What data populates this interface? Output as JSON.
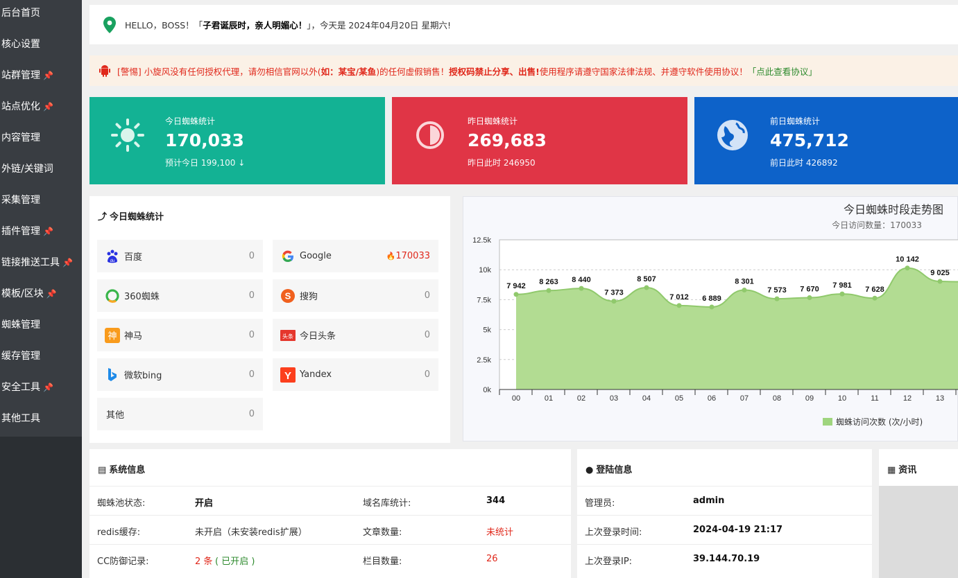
{
  "sidebar": {
    "items": [
      {
        "label": "后台首页",
        "pinned": false
      },
      {
        "label": "核心设置",
        "pinned": false
      },
      {
        "label": "站群管理",
        "pinned": true
      },
      {
        "label": "站点优化",
        "pinned": true
      },
      {
        "label": "内容管理",
        "pinned": false
      },
      {
        "label": "外链/关键词",
        "pinned": false
      },
      {
        "label": "采集管理",
        "pinned": false
      },
      {
        "label": "插件管理",
        "pinned": true
      },
      {
        "label": "链接推送工具",
        "pinned": true
      },
      {
        "label": "模板/区块",
        "pinned": true
      },
      {
        "label": "蜘蛛管理",
        "pinned": false
      },
      {
        "label": "缓存管理",
        "pinned": false
      },
      {
        "label": "安全工具",
        "pinned": true
      },
      {
        "label": "其他工具",
        "pinned": false
      }
    ]
  },
  "welcome": {
    "prefix": "HELLO，BOSS！「",
    "quote": "子君诞辰时，亲人明媚心！",
    "suffix": "」，今天是 2024年04月20日 星期六!"
  },
  "warning": {
    "p1": "[警惕] 小旋风没有任何授权代理，请勿相信官网以外(",
    "p2": "如：某宝/某鱼",
    "p3": ")的任何虚假销售！",
    "p4": "授权码禁止分享、出售!",
    "p5": " 使用程序请遵守国家法律法规、并遵守软件使用协议！",
    "link": "「点此查看协议」"
  },
  "stats": [
    {
      "title": "今日蜘蛛统计",
      "value": "170,033",
      "sub": "预计今日 199,100",
      "arrow": "↓",
      "color": "#13b294",
      "icon": "sun-icon"
    },
    {
      "title": "昨日蜘蛛统计",
      "value": "269,683",
      "sub": "昨日此时 246950",
      "arrow": "",
      "color": "#e03546",
      "icon": "half-circle-icon"
    },
    {
      "title": "前日蜘蛛统计",
      "value": "475,712",
      "sub": "前日此时 426892",
      "arrow": "",
      "color": "#0d62c9",
      "icon": "globe-icon"
    }
  ],
  "spider_panel": {
    "title": "今日蜘蛛统计",
    "engines": [
      {
        "name": "百度",
        "value": "0",
        "icon": "baidu-icon"
      },
      {
        "name": "Google",
        "value": "170033",
        "icon": "google-icon",
        "hot": true
      },
      {
        "name": "360蜘蛛",
        "value": "0",
        "icon": "360-icon"
      },
      {
        "name": "搜狗",
        "value": "0",
        "icon": "sogou-icon"
      },
      {
        "name": "神马",
        "value": "0",
        "icon": "shenma-icon"
      },
      {
        "name": "今日头条",
        "value": "0",
        "icon": "toutiao-icon"
      },
      {
        "name": "微软bing",
        "value": "0",
        "icon": "bing-icon"
      },
      {
        "name": "Yandex",
        "value": "0",
        "icon": "yandex-icon"
      },
      {
        "name": "其他",
        "value": "0",
        "icon": ""
      }
    ]
  },
  "chart_data": {
    "type": "area",
    "title": "今日蜘蛛时段走势图",
    "subtitle": "今日访问数量：170033",
    "categories": [
      "00",
      "01",
      "02",
      "03",
      "04",
      "05",
      "06",
      "07",
      "08",
      "09",
      "10",
      "11",
      "12",
      "13"
    ],
    "series": [
      {
        "name": "蜘蛛访问次数 (次/小时)",
        "values": [
          7942,
          8263,
          8440,
          7373,
          8507,
          7012,
          6889,
          8301,
          7573,
          7670,
          7981,
          7628,
          10142,
          9025
        ]
      }
    ],
    "data_labels": [
      "7 942",
      "8 263",
      "8 440",
      "7 373",
      "8 507",
      "7 012",
      "6 889",
      "8 301",
      "7 573",
      "7 670",
      "7 981",
      "7 628",
      "10 142",
      "9 025"
    ],
    "yticks": [
      "0k",
      "2.5k",
      "5k",
      "7.5k",
      "10k",
      "12.5k"
    ],
    "ylim": [
      0,
      12500
    ],
    "grid": true,
    "legend": "bottom-right",
    "color": "#9fd57e"
  },
  "system": {
    "title": "系统信息",
    "rows": [
      {
        "k1": "蜘蛛池状态:",
        "v1": "开启",
        "k2": "域名库统计:",
        "v2": "344"
      },
      {
        "k1": "redis缓存:",
        "v1": "未开启（未安装redis扩展）",
        "k2": "文章数量:",
        "v2": "未统计"
      },
      {
        "k1": "CC防御记录:",
        "v1a": "2 条",
        "v1b": "( 已开启 )",
        "k2": "栏目数量:",
        "v2": "26"
      }
    ]
  },
  "login": {
    "title": "登陆信息",
    "rows": [
      {
        "k": "管理员:",
        "v": "admin"
      },
      {
        "k": "上次登录时间:",
        "v": "2024-04-19 21:17"
      },
      {
        "k": "上次登录IP:",
        "v": "39.144.70.19"
      }
    ]
  },
  "news": {
    "title": "资讯"
  }
}
